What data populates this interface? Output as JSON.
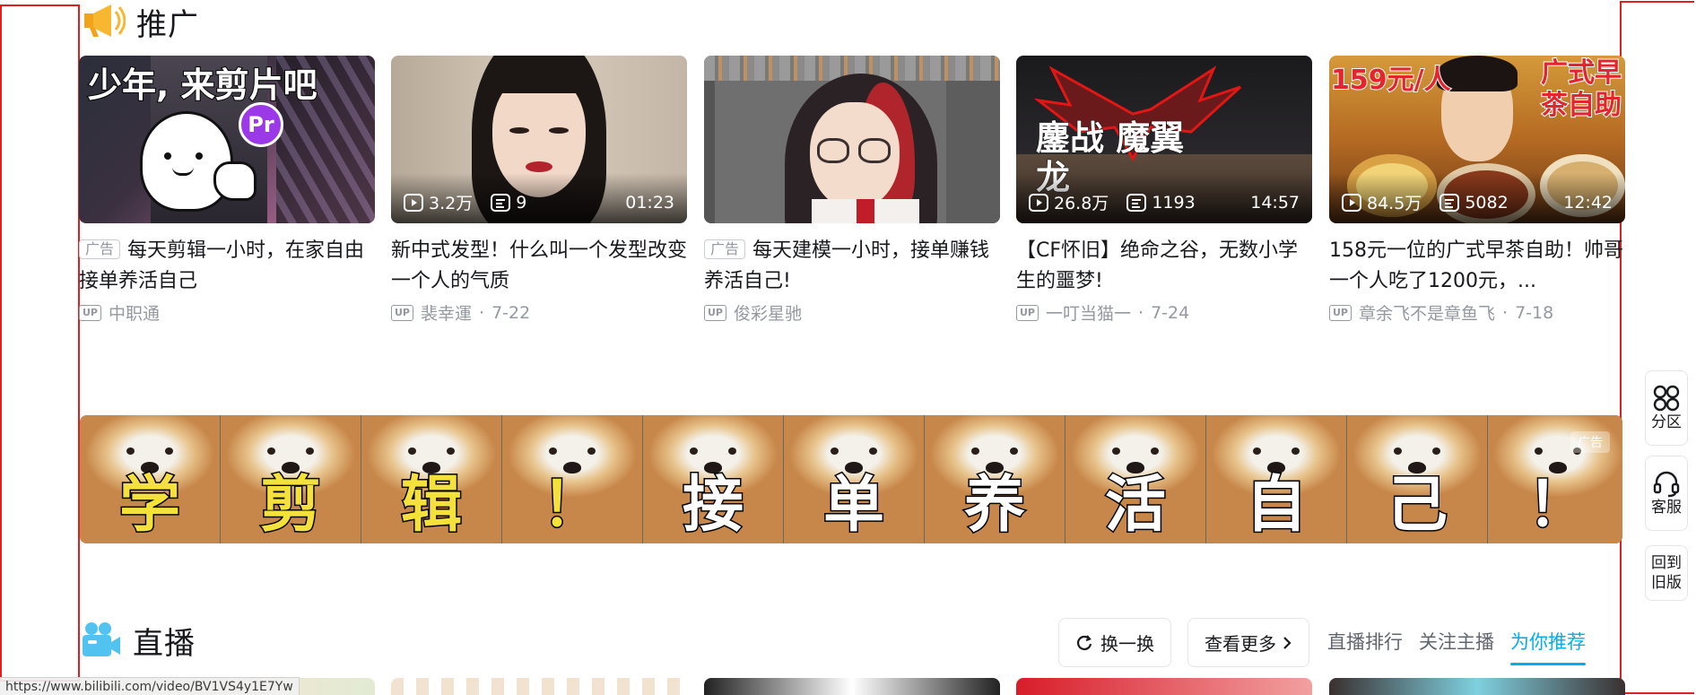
{
  "promo": {
    "title": "推广",
    "cards": [
      {
        "thumb_text": "少年, 来剪片吧",
        "thumb_badge": "Pr",
        "ad_label": "广告",
        "title": "每天剪辑一小时，在家自由接单养活自己",
        "author": "中职通",
        "date": ""
      },
      {
        "views": "3.2万",
        "comments": "9",
        "duration": "01:23",
        "title": "新中式发型！什么叫一个发型改变一个人的气质",
        "author": "裴幸運",
        "date": "7-22"
      },
      {
        "ad_label": "广告",
        "title": "每天建模一小时，接单赚钱养活自己!",
        "author": "俊彩星驰",
        "date": ""
      },
      {
        "thumb_text": "鏖战 魔翼龙",
        "views": "26.8万",
        "comments": "1193",
        "duration": "14:57",
        "title": "【CF怀旧】绝命之谷，无数小学生的噩梦!",
        "author": "一叮当猫一",
        "date": "7-24"
      },
      {
        "thumb_text_left": "159元/人",
        "thumb_text_right": "广式早茶自助",
        "views": "84.5万",
        "comments": "5082",
        "duration": "12:42",
        "title": "158元一位的广式早茶自助！帅哥一个人吃了1200元，...",
        "author": "章余飞不是章鱼飞",
        "date": "7-18"
      }
    ],
    "up_label": "UP"
  },
  "banner": {
    "chars": [
      "学",
      "剪",
      "辑",
      "！",
      "接",
      "单",
      "养",
      "活",
      "自",
      "己",
      "！"
    ],
    "char_colors": [
      "#f5e13b",
      "#f5e13b",
      "#f5e13b",
      "#f5e13b",
      "#ffffff",
      "#ffffff",
      "#ffffff",
      "#ffffff",
      "#ffffff",
      "#ffffff",
      "#ffffff"
    ],
    "ad_label": "广告"
  },
  "live": {
    "title": "直播",
    "refresh_label": "换一换",
    "more_label": "查看更多",
    "tabs": [
      "直播排行",
      "关注主播",
      "为你推荐"
    ],
    "active_tab": "为你推荐"
  },
  "side": {
    "zone_label": "分区",
    "service_label": "客服",
    "old_label_1": "回到",
    "old_label_2": "旧版"
  },
  "statusbar": {
    "url": "https://www.bilibili.com/video/BV1VS4y1E7Yw"
  },
  "colors": {
    "accent": "#00aeec",
    "frame": "#e02020",
    "promo_icon": "#f7b730",
    "live_icon": "#52c3f1"
  }
}
